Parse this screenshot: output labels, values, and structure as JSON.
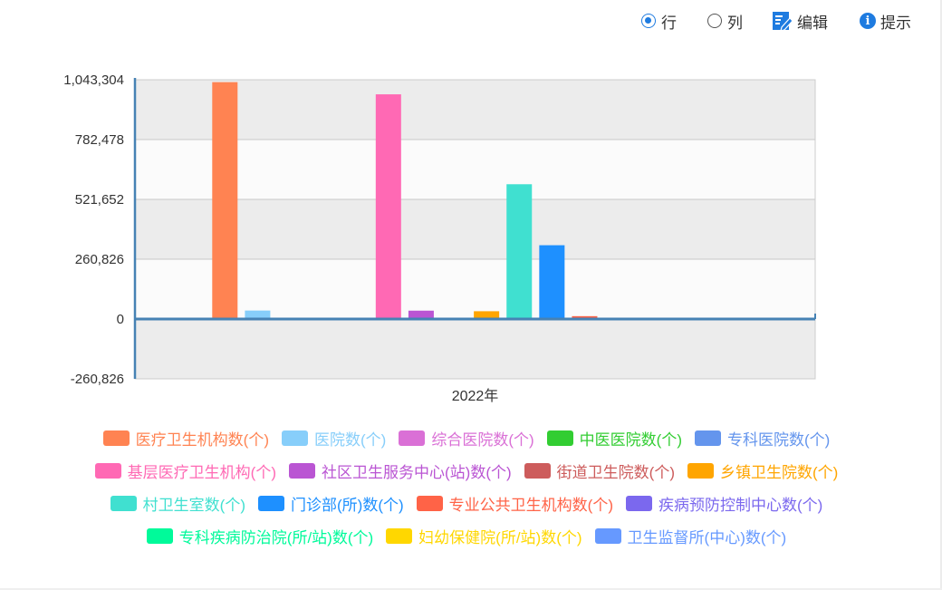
{
  "toolbar": {
    "row_label": "行",
    "column_label": "列",
    "edit_label": "编辑",
    "tip_label": "提示",
    "selected": "row"
  },
  "chart_data": {
    "type": "bar",
    "categories": [
      "2022年"
    ],
    "ylim": [
      -260826,
      1043304
    ],
    "yticks": [
      1043304,
      782478,
      521652,
      260826,
      0,
      -260826
    ],
    "ytick_labels": [
      "1,043,304",
      "782,478",
      "521,652",
      "260,826",
      "0",
      "-260,826"
    ],
    "grid": true,
    "legend_position": "bottom",
    "series": [
      {
        "name": "医疗卫生机构数(个)",
        "color": "#ff8352",
        "values": [
          1032918
        ]
      },
      {
        "name": "医院数(个)",
        "color": "#87cefa",
        "values": [
          36976
        ]
      },
      {
        "name": "综合医院数(个)",
        "color": "#da70d6",
        "values": [
          0
        ]
      },
      {
        "name": "中医医院数(个)",
        "color": "#32cd32",
        "values": [
          0
        ]
      },
      {
        "name": "专科医院数(个)",
        "color": "#6495ed",
        "values": [
          0
        ]
      },
      {
        "name": "基层医疗卫生机构(个)",
        "color": "#ff69b4",
        "values": [
          979768
        ]
      },
      {
        "name": "社区卫生服务中心(站)数(个)",
        "color": "#ba55d3",
        "values": [
          36448
        ]
      },
      {
        "name": "街道卫生院数(个)",
        "color": "#cd5c5c",
        "values": [
          0
        ]
      },
      {
        "name": "乡镇卫生院数(个)",
        "color": "#ffa500",
        "values": [
          33917
        ]
      },
      {
        "name": "村卫生室数(个)",
        "color": "#40e0d0",
        "values": [
          587749
        ]
      },
      {
        "name": "门诊部(所)数(个)",
        "color": "#1e90ff",
        "values": [
          321775
        ]
      },
      {
        "name": "专业公共卫生机构数(个)",
        "color": "#ff6347",
        "values": [
          12436
        ]
      },
      {
        "name": "疾病预防控制中心数(个)",
        "color": "#7b68ee",
        "values": [
          3386
        ]
      },
      {
        "name": "专科疾病防治院(所/站)数(个)",
        "color": "#00fa9a",
        "values": [
          0
        ]
      },
      {
        "name": "妇幼保健院(所/站)数(个)",
        "color": "#ffd700",
        "values": [
          0
        ]
      },
      {
        "name": "卫生监督所(中心)数(个)",
        "color": "#6699ff",
        "values": [
          0
        ]
      }
    ]
  }
}
